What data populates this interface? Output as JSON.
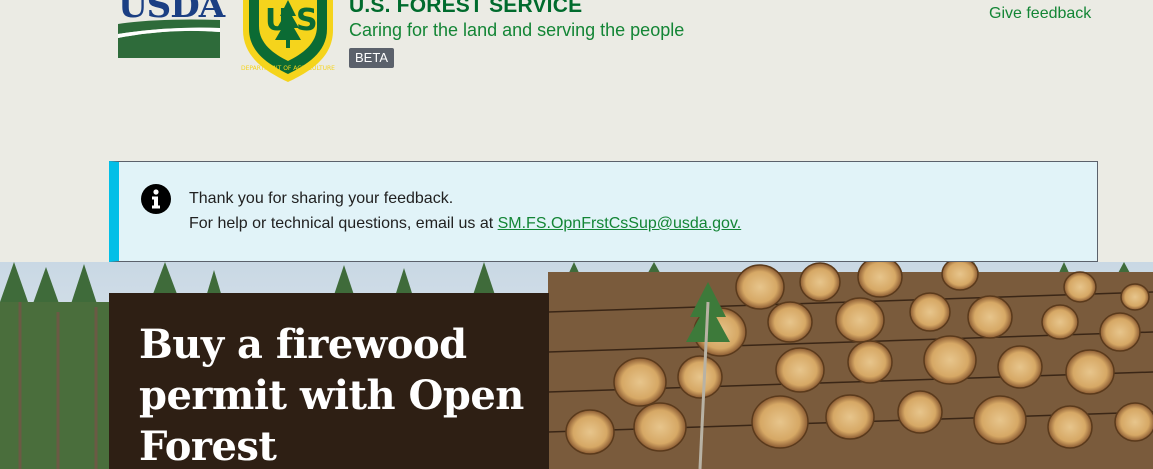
{
  "header": {
    "usda_logo_text": "USDA",
    "shield_text": "U S",
    "shield_ring_text": "DEPARTMENT OF AGRICULTURE",
    "agency_name": "U.S. FOREST SERVICE",
    "tagline": "Caring for the land and serving the people",
    "beta_label": "BETA",
    "give_feedback_label": "Give feedback"
  },
  "alert": {
    "icon": "info-icon",
    "message": "Thank you for sharing your feedback.",
    "help_prefix": "For help or technical questions, email us at ",
    "email": "SM.FS.OpnFrstCsSup@usda.gov."
  },
  "hero": {
    "title": "Buy a firewood permit with Open Forest",
    "image": "forest-and-log-pile-photo"
  },
  "colors": {
    "page_bg": "#ebebe4",
    "forest_green": "#006b2d",
    "link_green": "#138535",
    "alert_bg": "#e1f3f8",
    "alert_accent": "#02bfe7",
    "hero_card_bg": "#2e1f14",
    "usda_blue": "#1b3f83"
  }
}
